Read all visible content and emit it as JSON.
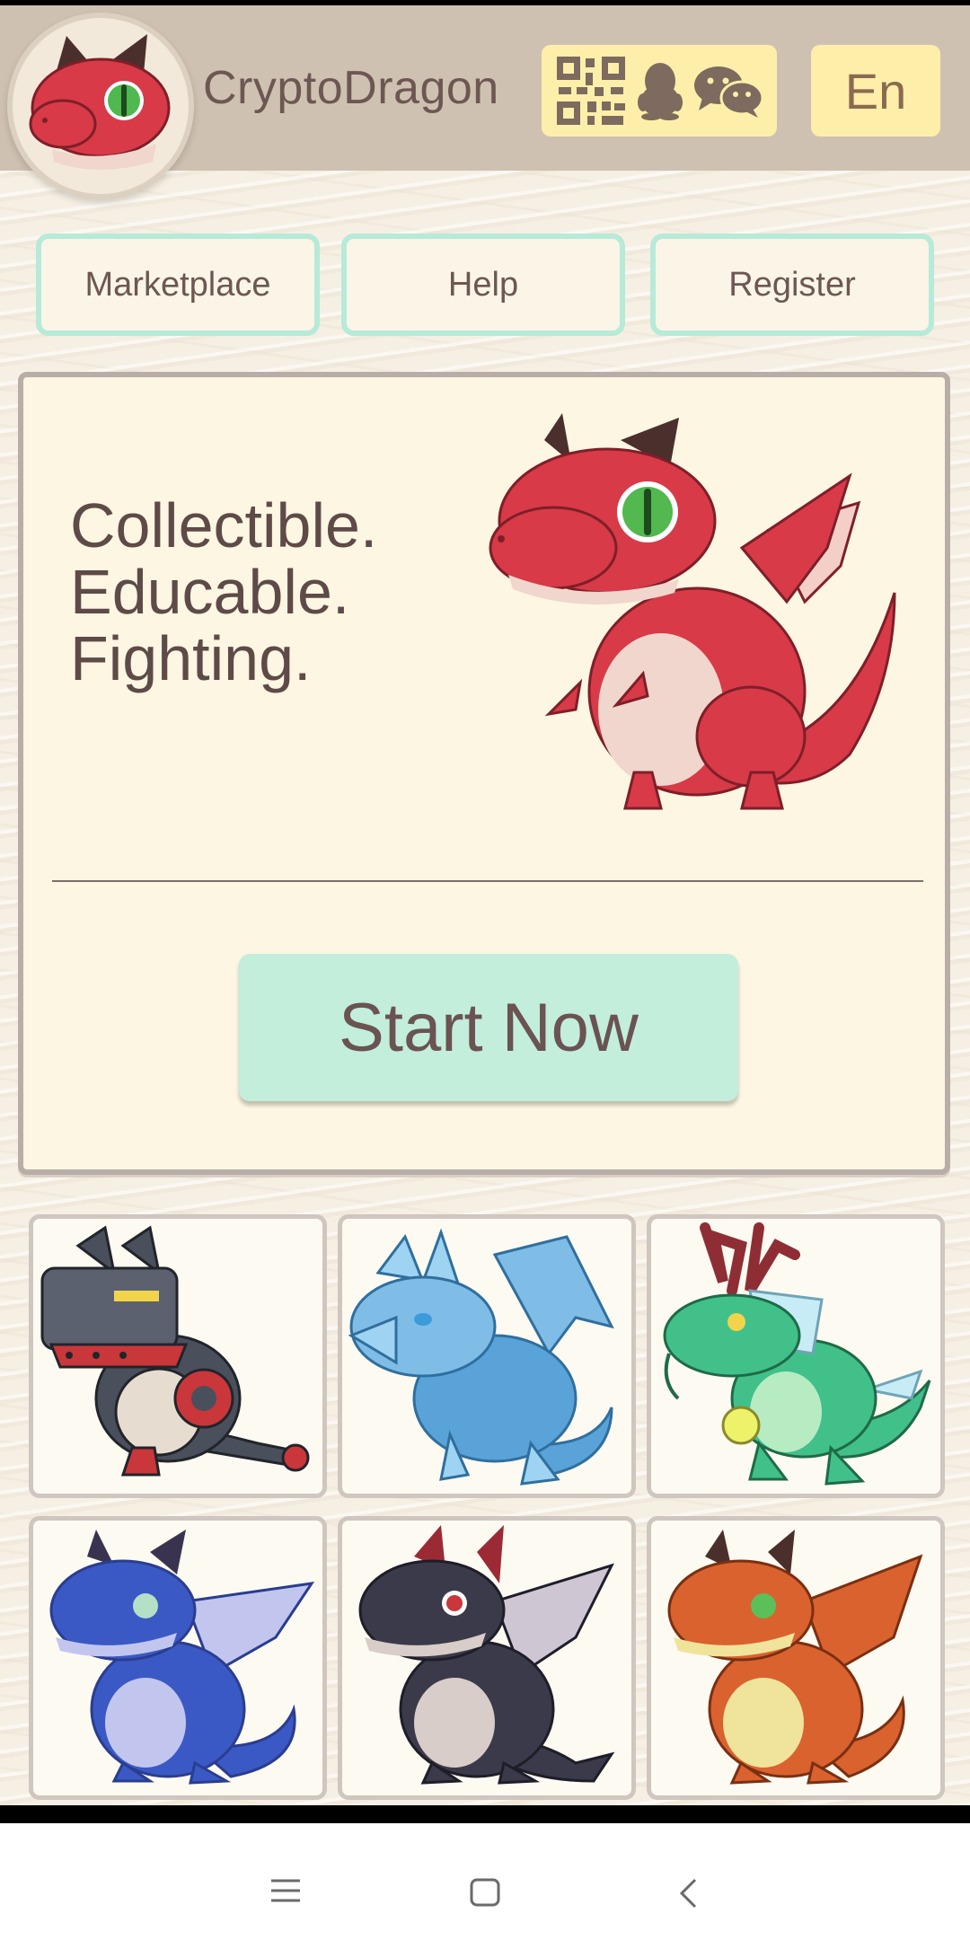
{
  "app": {
    "title": "CryptoDragon",
    "language_label": "En",
    "social_icons": [
      "qr-code-icon",
      "qq-icon",
      "wechat-icon"
    ]
  },
  "nav": {
    "items": [
      {
        "label": "Marketplace"
      },
      {
        "label": "Help"
      },
      {
        "label": "Register"
      }
    ]
  },
  "hero": {
    "tagline": [
      "Collectible.",
      "Educable.",
      "Fighting."
    ],
    "cta_label": "Start Now"
  },
  "gallery": {
    "dragons": [
      {
        "name": "mech-dragon",
        "primary_color": "#4a4f5c",
        "accent_color": "#c9373a"
      },
      {
        "name": "ice-dragon",
        "primary_color": "#5aa3d8",
        "accent_color": "#9fd3f2"
      },
      {
        "name": "jade-dragon",
        "primary_color": "#41c08a",
        "accent_color": "#8e2e34"
      },
      {
        "name": "blue-dragon",
        "primary_color": "#3a59c4",
        "accent_color": "#c2c6ee"
      },
      {
        "name": "shadow-dragon",
        "primary_color": "#3b3a4a",
        "accent_color": "#9c2a35"
      },
      {
        "name": "orange-dragon",
        "primary_color": "#d9622e",
        "accent_color": "#f0e39b"
      }
    ]
  },
  "system_nav": {
    "icons": [
      "menu-icon",
      "home-icon",
      "back-icon"
    ]
  },
  "colors": {
    "header_bg": "#cfc1b1",
    "button_yellow": "#fdefa9",
    "nav_border": "#b7ead8",
    "cta_bg": "#c2eedb",
    "text": "#6d5752"
  }
}
